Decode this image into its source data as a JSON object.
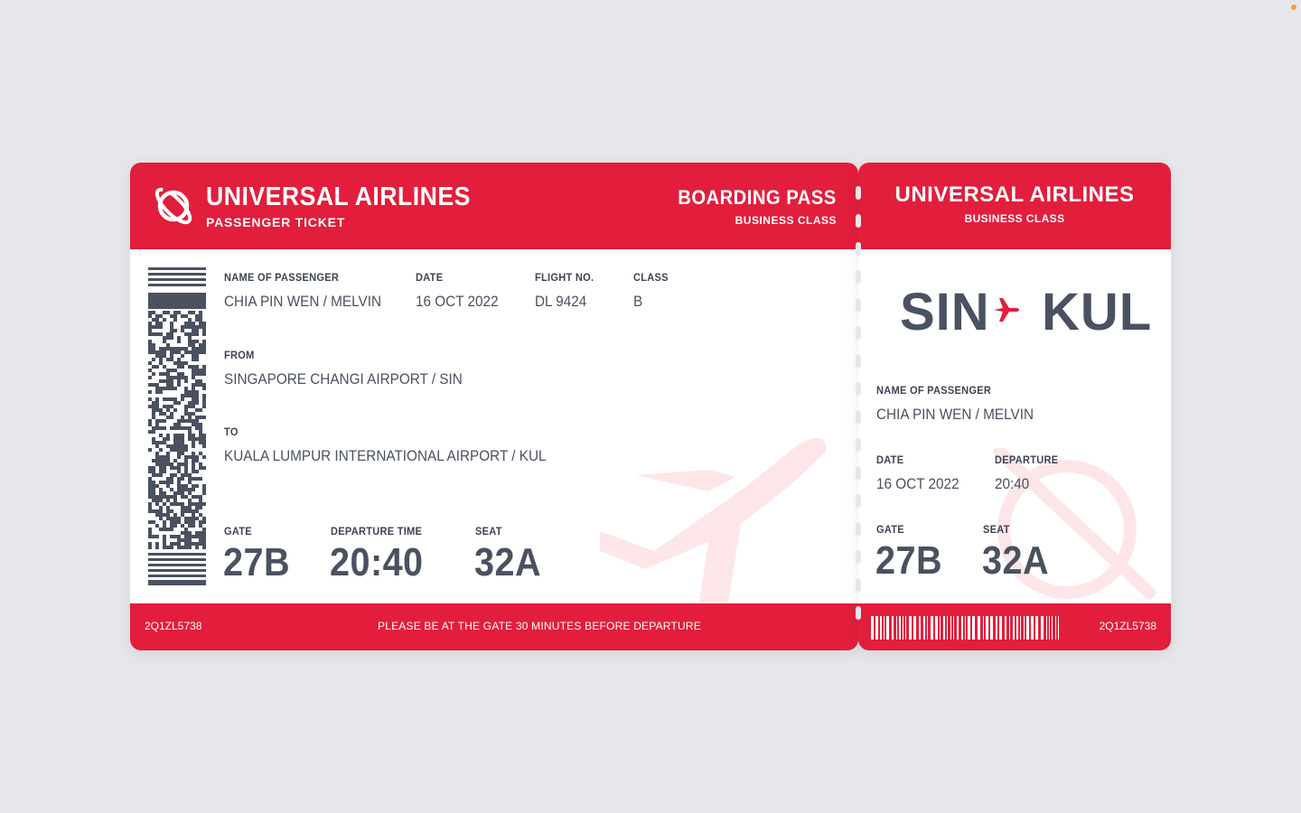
{
  "colors": {
    "brand": "#e21e3c",
    "text": "#4a5160",
    "background": "#e6e7ea"
  },
  "main": {
    "airline_name": "UNIVERSAL AIRLINES",
    "ticket_type": "PASSENGER TICKET",
    "pass_title": "BOARDING PASS",
    "class_name": "BUSINESS CLASS",
    "logo_icon": "planet-icon",
    "fields": {
      "passenger_label": "NAME OF PASSENGER",
      "passenger_value": "CHIA PIN WEN / MELVIN",
      "date_label": "DATE",
      "date_value": "16 OCT 2022",
      "flight_label": "FLIGHT NO.",
      "flight_value": "DL 9424",
      "class_label": "CLASS",
      "class_value": "B",
      "from_label": "FROM",
      "from_value": "SINGAPORE CHANGI AIRPORT / SIN",
      "to_label": "TO",
      "to_value": "KUALA LUMPUR INTERNATIONAL AIRPORT / KUL",
      "gate_label": "GATE",
      "gate_value": "27B",
      "departure_label": "DEPARTURE TIME",
      "departure_value": "20:40",
      "seat_label": "SEAT",
      "seat_value": "32A"
    },
    "footer": {
      "code": "2Q1ZL5738",
      "message": "PLEASE BE AT THE GATE 30 MINUTES BEFORE DEPARTURE"
    }
  },
  "stub": {
    "airline_name": "UNIVERSAL AIRLINES",
    "class_name": "BUSINESS CLASS",
    "origin": "SIN",
    "destination": "KUL",
    "route_icon": "airplane-icon",
    "passenger_label": "NAME OF PASSENGER",
    "passenger_value": "CHIA PIN WEN / MELVIN",
    "date_label": "DATE",
    "date_value": "16 OCT 2022",
    "departure_label": "DEPARTURE",
    "departure_value": "20:40",
    "gate_label": "GATE",
    "gate_value": "27B",
    "seat_label": "SEAT",
    "seat_value": "32A",
    "code": "2Q1ZL5738"
  }
}
